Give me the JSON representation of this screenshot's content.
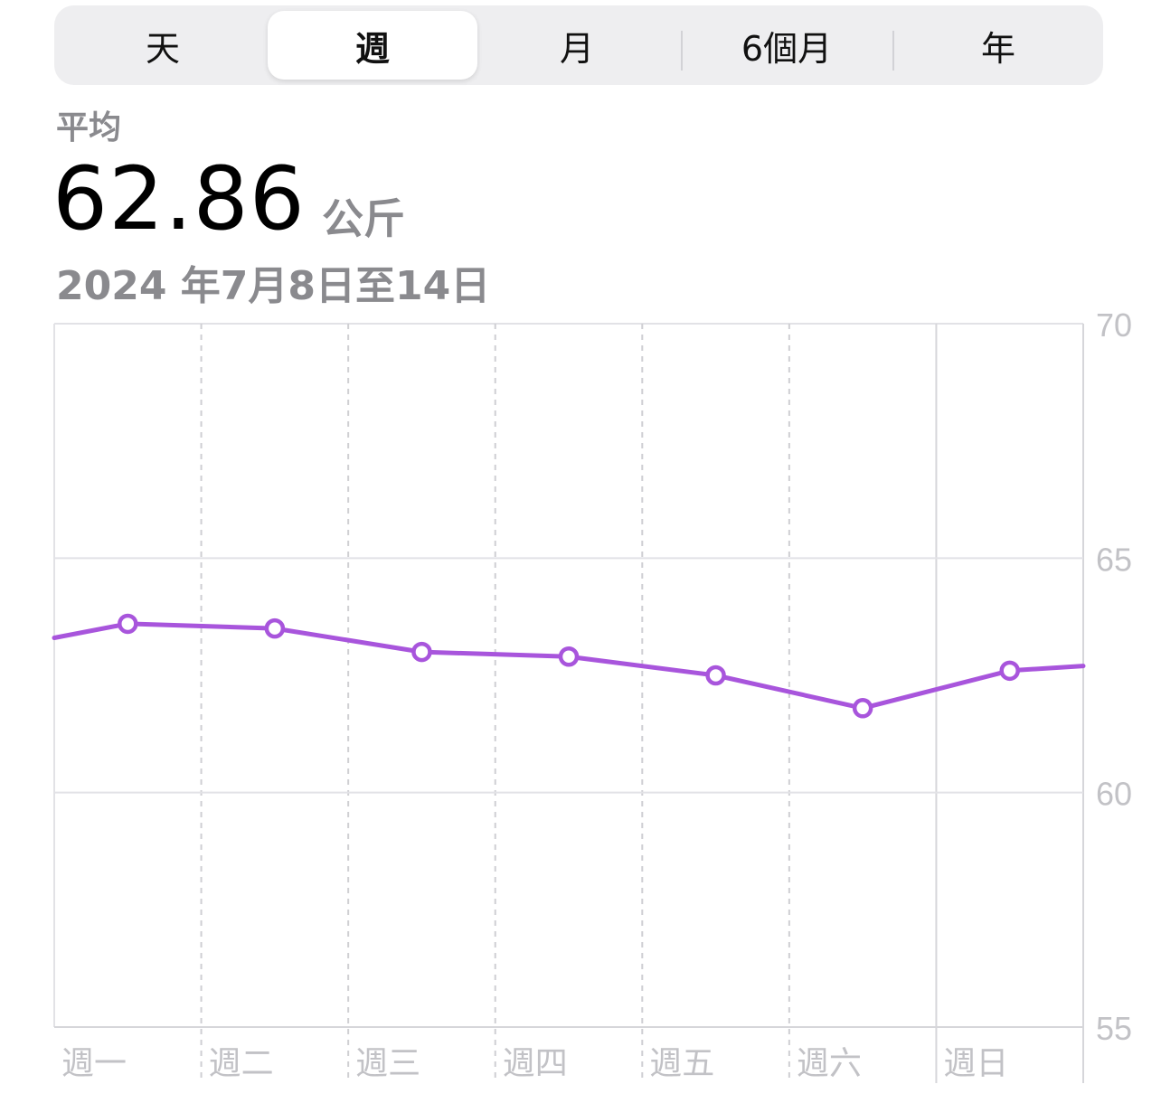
{
  "tabs": [
    {
      "label": "天",
      "selected": false
    },
    {
      "label": "週",
      "selected": true
    },
    {
      "label": "月",
      "selected": false
    },
    {
      "label": "6個月",
      "selected": false
    },
    {
      "label": "年",
      "selected": false
    }
  ],
  "summary": {
    "label": "平均",
    "value": "62.86",
    "unit": "公斤",
    "date_range": "2024 年7月8日至14日"
  },
  "colors": {
    "line": "#a855dc",
    "grid": "#e2e2e6",
    "axis_text": "#c2c2c6"
  },
  "chart_data": {
    "type": "line",
    "categories": [
      "週一",
      "週二",
      "週三",
      "週四",
      "週五",
      "週六",
      "週日"
    ],
    "series": [
      {
        "values": [
          63.6,
          63.5,
          63.0,
          62.9,
          62.5,
          61.8,
          62.6
        ]
      }
    ],
    "line_start_value": 63.3,
    "line_end_value": 62.7,
    "yticks": [
      70,
      65,
      60,
      55
    ],
    "ylim": [
      55,
      70
    ],
    "y_axis_position": "right",
    "grid": true
  }
}
